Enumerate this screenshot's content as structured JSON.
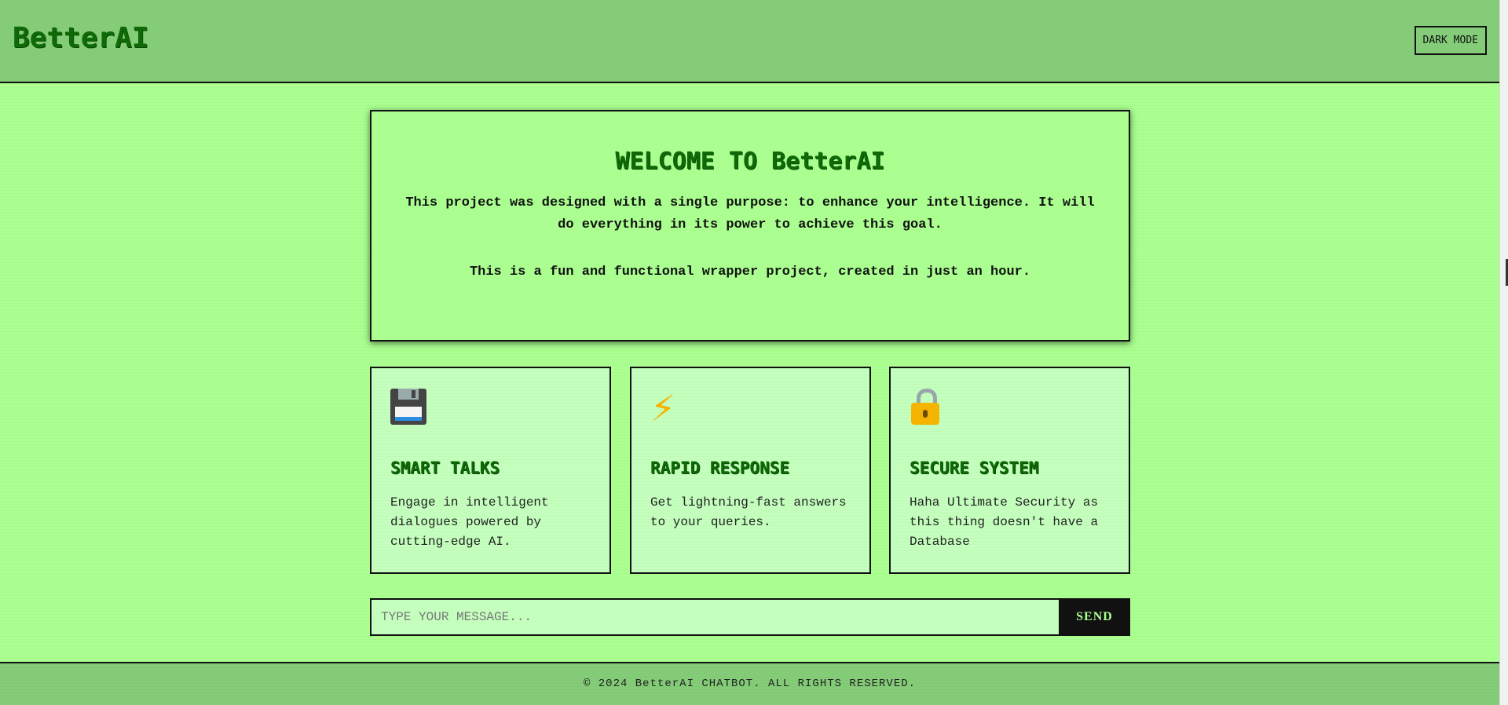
{
  "header": {
    "logo": "BetterAI",
    "mode_button": "DARK MODE"
  },
  "welcome": {
    "title": "WELCOME TO BetterAI",
    "paragraph1": "This project was designed with a single purpose: to enhance your intelligence. It will do everything in its power to achieve this goal.",
    "paragraph2": "This is a fun and functional wrapper project, created in just an hour."
  },
  "features": [
    {
      "icon": "floppy-disk-icon",
      "title": "SMART TALKS",
      "description": "Engage in intelligent dialogues powered by cutting-edge AI."
    },
    {
      "icon": "lightning-icon",
      "title": "RAPID RESPONSE",
      "description": "Get lightning-fast answers to your queries."
    },
    {
      "icon": "lock-icon",
      "title": "SECURE SYSTEM",
      "description": "Haha Ultimate Security as this thing doesn't have a Database"
    }
  ],
  "chat": {
    "placeholder": "TYPE YOUR MESSAGE...",
    "send_label": "SEND"
  },
  "footer": {
    "text": "© 2024 BetterAI CHATBOT. ALL RIGHTS RESERVED."
  },
  "colors": {
    "background": "#aaff90",
    "header": "#84cc78",
    "accent_text": "#0e6a06",
    "card": "#c4ffbe",
    "button": "#111111"
  }
}
